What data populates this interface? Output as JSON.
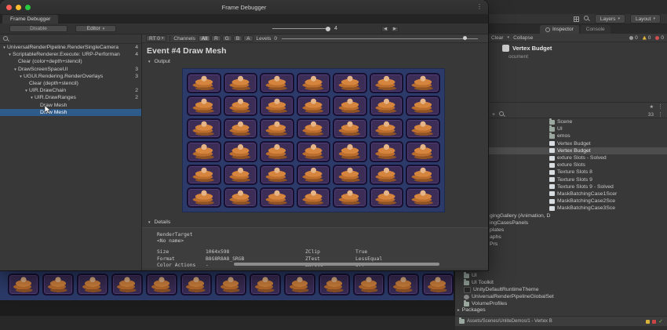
{
  "icons": {
    "caret_down": "▾",
    "foldout_open": "▼",
    "prev": "◀",
    "next": "▶",
    "packages_arrow": "▸",
    "menu_dots": "⋮",
    "plus": "+",
    "star": "★",
    "check": "✓"
  },
  "frame_debugger": {
    "title": "Frame Debugger",
    "tab_label": "Frame Debugger",
    "toolbar": {
      "disable_label": "Disable",
      "editor_label": "Editor",
      "event_value": "4"
    },
    "search_placeholder": "",
    "tree_items": [
      {
        "label": "UniversalRenderPipeline.RenderSingleCamera",
        "count": "4",
        "level": 0,
        "expanded": true,
        "selected": false
      },
      {
        "label": "ScriptableRenderer.Execute: URP-Performan",
        "count": "4",
        "level": 1,
        "expanded": true,
        "selected": false
      },
      {
        "label": "Clear (color+depth+stencil)",
        "count": "",
        "level": 2,
        "expanded": false,
        "selected": false
      },
      {
        "label": "DrawScreenSpaceUI",
        "count": "3",
        "level": 2,
        "expanded": true,
        "selected": false
      },
      {
        "label": "UGUI.Rendering.RenderOverlays",
        "count": "3",
        "level": 3,
        "expanded": true,
        "selected": false
      },
      {
        "label": "Clear (depth+stencil)",
        "count": "",
        "level": 4,
        "expanded": false,
        "selected": false
      },
      {
        "label": "UIR.DrawChain",
        "count": "2",
        "level": 4,
        "expanded": true,
        "selected": false
      },
      {
        "label": "UIR.DrawRanges",
        "count": "2",
        "level": 5,
        "expanded": true,
        "selected": false
      },
      {
        "label": "Draw Mesh",
        "count": "",
        "level": 6,
        "expanded": false,
        "selected": false
      },
      {
        "label": "Draw Mesh",
        "count": "",
        "level": 6,
        "expanded": false,
        "selected": true
      }
    ],
    "rt_toolbar": {
      "rt_label": "RT 0",
      "channels_label": "Channels",
      "channel_buttons": [
        "All",
        "R",
        "G",
        "B",
        "A"
      ],
      "levels_label": "Levels",
      "levels_min": "0"
    },
    "event_heading": "Event #4 Draw Mesh",
    "output_section_label": "Output",
    "details_section_label": "Details",
    "details": {
      "render_target_label": "RenderTarget",
      "render_target_name": "<No name>",
      "left_rows": [
        {
          "key": "Size",
          "value": "1064x598"
        },
        {
          "key": "Format",
          "value": "B8G8R8A8_SRGB"
        },
        {
          "key": "Color Actions",
          "value": "-"
        }
      ],
      "right_rows": [
        {
          "key": "ZClip",
          "value": "True"
        },
        {
          "key": "ZTest",
          "value": "LessEqual"
        },
        {
          "key": "ZWrite",
          "value": "Off"
        }
      ]
    },
    "output_preview": {
      "grid_cols": 7,
      "grid_rows": 6,
      "bg_color": "#2b3a68",
      "tile_color": "#3b2d56",
      "character_color": "#d5853e"
    }
  },
  "editor": {
    "topbar": {
      "layers_label": "Layers",
      "layout_label": "Layout"
    },
    "panel_tabs": [
      {
        "label": "Inspector"
      },
      {
        "label": "Console"
      }
    ],
    "console_toolbar": {
      "clear_label": "Clear",
      "collapse_label": "Collapse",
      "counts": [
        {
          "icon": "info",
          "value": "0"
        },
        {
          "icon": "warning",
          "value": "0"
        },
        {
          "icon": "error",
          "value": "0"
        }
      ]
    },
    "asset_header": {
      "title": "Vertex Budget",
      "subtitle": "ocument"
    },
    "project_toolbar": {
      "badge": "33"
    },
    "project_items_deep": [
      {
        "label": "Scene",
        "icon": "folder",
        "selected": false
      },
      {
        "label": "UI",
        "icon": "folder",
        "selected": false
      },
      {
        "label": "emos",
        "icon": "folder",
        "selected": false
      },
      {
        "label": "Vertex Budget",
        "icon": "scene",
        "selected": false
      },
      {
        "label": "Vertex Budget",
        "icon": "scene",
        "selected": true
      },
      {
        "label": "exture Slots - Solved",
        "icon": "scene",
        "selected": false
      },
      {
        "label": "exture Slots",
        "icon": "scene",
        "selected": false
      },
      {
        "label": "Texture Slots 8",
        "icon": "scene",
        "selected": false
      },
      {
        "label": "Texture Slots 9",
        "icon": "scene",
        "selected": false
      },
      {
        "label": "Texture Slots 9 - Solved",
        "icon": "scene",
        "selected": false
      },
      {
        "label": "MaskBatchingCase1Scer",
        "icon": "scene",
        "selected": false
      },
      {
        "label": "MaskBatchingCase2Sce",
        "icon": "scene",
        "selected": false
      },
      {
        "label": "MaskBatchingCase3Sce",
        "icon": "scene",
        "selected": false
      },
      {
        "label": "gingGallery (Animation, D",
        "icon": "none",
        "selected": false
      },
      {
        "label": "ingCasesPanels",
        "icon": "none",
        "selected": false
      },
      {
        "label": "plates",
        "icon": "none",
        "selected": false
      },
      {
        "label": "aphs",
        "icon": "none",
        "selected": false
      },
      {
        "label": "Prs",
        "icon": "none",
        "selected": false
      }
    ],
    "project_items_shallow": [
      {
        "label": "UI",
        "icon": "folder"
      },
      {
        "label": "UI Toolkit",
        "icon": "folder"
      },
      {
        "label": "UnityDefaultRuntimeTheme",
        "icon": "theme"
      },
      {
        "label": "UniversalRenderPipelineGlobalSet",
        "icon": "settings"
      },
      {
        "label": "VolumeProfiles",
        "icon": "folder"
      }
    ],
    "packages_label": "Packages",
    "status_bar": {
      "path": "Assets/Scenes/UnliteDemos/1 - Vertex B"
    }
  },
  "game_view": {
    "tile_count": 13,
    "bg_color": "#2b3a68"
  }
}
